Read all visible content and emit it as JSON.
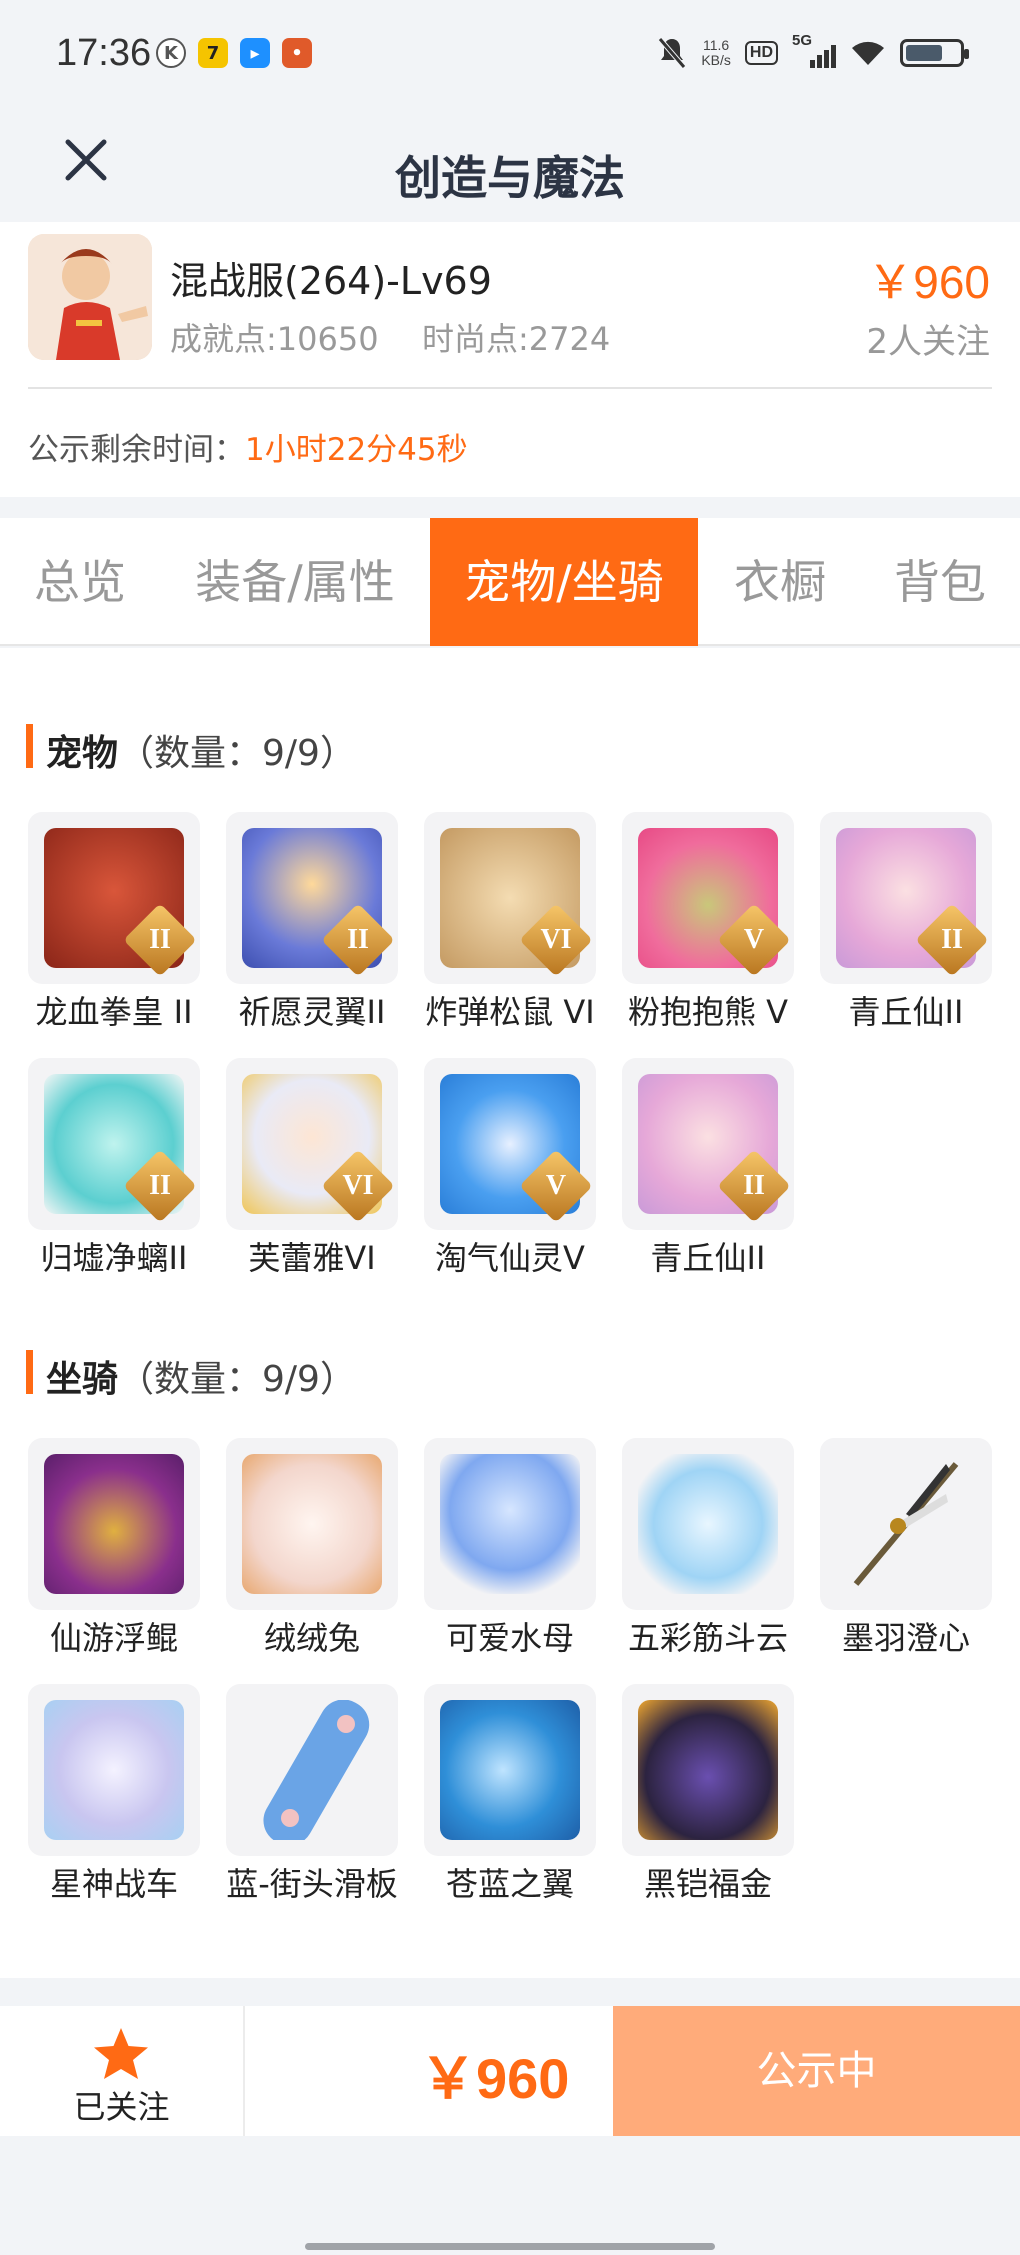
{
  "status_bar": {
    "time": "17:36",
    "net_speed_value": "11.6",
    "net_speed_unit": "KB/s",
    "hd_label": "HD",
    "signal_label": "5G",
    "icons": [
      "k-icon",
      "qq-browser-icon",
      "bilibili-icon",
      "game-icon",
      "mute-icon",
      "wifi-icon",
      "battery-icon"
    ]
  },
  "nav": {
    "title": "创造与魔法",
    "close_icon": "close-icon"
  },
  "product": {
    "name": "混战服(264)-Lv69",
    "achievement": "成就点:10650",
    "fashion": "时尚点:2724",
    "price": "￥960",
    "followers": "2人关注",
    "countdown_label": "公示剩余时间：",
    "countdown_value": "1小时22分45秒"
  },
  "tabs": [
    {
      "label": "总览",
      "active": false
    },
    {
      "label": "装备/属性",
      "active": false
    },
    {
      "label": "宠物/坐骑",
      "active": true
    },
    {
      "label": "衣橱",
      "active": false
    },
    {
      "label": "背包",
      "active": false
    }
  ],
  "pets": {
    "title": "宠物",
    "count": "（数量：9/9）",
    "items": [
      {
        "name": "龙血拳皇 II",
        "rank": "II"
      },
      {
        "name": "祈愿灵翼II",
        "rank": "II"
      },
      {
        "name": "炸弹松鼠 VI",
        "rank": "VI"
      },
      {
        "name": "粉抱抱熊 V",
        "rank": "V"
      },
      {
        "name": "青丘仙II",
        "rank": "II"
      },
      {
        "name": "归墟净螭II",
        "rank": "II"
      },
      {
        "name": "芙蕾雅VI",
        "rank": "VI"
      },
      {
        "name": "淘气仙灵V",
        "rank": "V"
      },
      {
        "name": "青丘仙II",
        "rank": "II"
      }
    ]
  },
  "mounts": {
    "title": "坐骑",
    "count": "（数量：9/9）",
    "items": [
      {
        "name": "仙游浮鲲"
      },
      {
        "name": "绒绒兔"
      },
      {
        "name": "可爱水母"
      },
      {
        "name": "五彩筋斗云"
      },
      {
        "name": "墨羽澄心"
      },
      {
        "name": "星神战车"
      },
      {
        "name": "蓝-街头滑板"
      },
      {
        "name": "苍蓝之翼"
      },
      {
        "name": "黑铠福金"
      }
    ]
  },
  "bottom": {
    "follow_label": "已关注",
    "price": "￥960",
    "status_label": "公示中"
  },
  "colors": {
    "accent": "#ff6a14",
    "status_btn": "#ffab7a",
    "title": "#2c3444"
  }
}
